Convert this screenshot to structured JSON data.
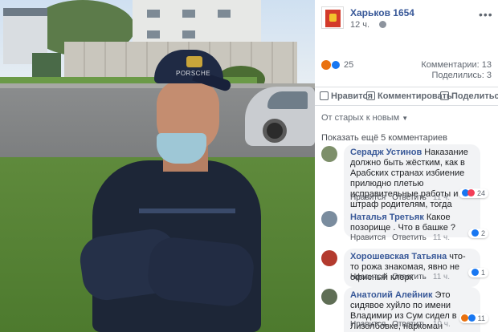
{
  "post": {
    "page_name": "Харьков 1654",
    "time": "12 ч.",
    "reactions_count": "25",
    "comments_label": "Комментарии: 13",
    "shares_label": "Поделились: 3"
  },
  "photo": {
    "cap_text": "PORSCHE"
  },
  "actions": {
    "like": "Нравится",
    "comment": "Комментировать",
    "share": "Поделиться"
  },
  "sort": {
    "label": "От старых к новым"
  },
  "show_more": "Показать ещё 5 комментариев",
  "comments": [
    {
      "author": "Сeрадж Устинов",
      "text": "Наказание должно быть жёстким, как в Арабских странах избиение прилюдно плетью исправительные работы и штраф родителям, тогда другим будет урок.",
      "like": "Нравится",
      "reply": "Ответить",
      "time": "11 ч.",
      "reactions": "24"
    },
    {
      "author": "Наталья Третьяк",
      "text": "Какое позорище . Что в башке ?",
      "like": "Нравится",
      "reply": "Ответить",
      "time": "11 ч.",
      "reactions": "2"
    },
    {
      "author": "Хорошевская Татьяна",
      "text": "что-то рожа знакомая, явно не офисный клерк",
      "like": "Нравится",
      "reply": "Ответить",
      "time": "11 ч.",
      "reactions": "1"
    },
    {
      "author": "Анатолий Алейник",
      "text": "Это сидявое хуйло по имени Владимир из Сум сидел в Лизолбовке, наркоман солевик.",
      "like": "Нравится",
      "reply": "Ответить",
      "time": "10 ч.",
      "reactions": "11"
    }
  ],
  "colors": {
    "link_blue": "#385898",
    "like_blue": "#1877f2",
    "bubble_gray": "#f2f3f5"
  }
}
